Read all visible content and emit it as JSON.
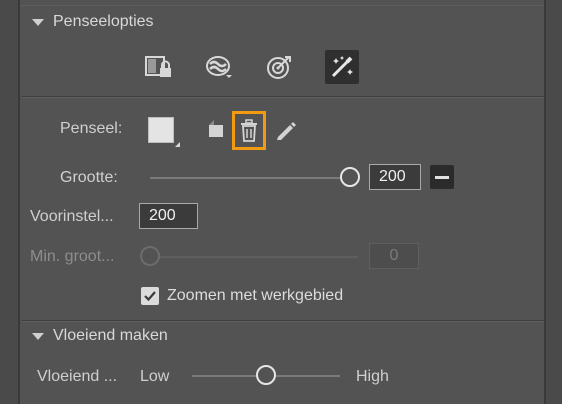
{
  "brush_options": {
    "title": "Penseelopties",
    "tools": [
      {
        "icon": "lock-layer-icon"
      },
      {
        "icon": "eraser-mode-icon"
      },
      {
        "icon": "target-icon"
      },
      {
        "icon": "magic-brush-icon",
        "active": true
      }
    ]
  },
  "brush": {
    "label": "Penseel:",
    "swatch_icon": "brush-swatch",
    "new_icon": "new-brush-icon",
    "delete_icon": "trash-icon",
    "edit_icon": "pencil-icon",
    "highlight_color": "#f29a12"
  },
  "size": {
    "label": "Grootte:",
    "value": "200",
    "slider_fraction": 1.0
  },
  "preset": {
    "label": "Voorinstel...",
    "value": "200"
  },
  "min_size": {
    "label": "Min. groot...",
    "value": "0",
    "slider_fraction": 0.0
  },
  "zoom": {
    "label": "Zoomen met werkgebied",
    "checked": true
  },
  "smoothing": {
    "title": "Vloeiend maken",
    "label": "Vloeiend ...",
    "low": "Low",
    "high": "High",
    "slider_fraction": 0.5
  }
}
